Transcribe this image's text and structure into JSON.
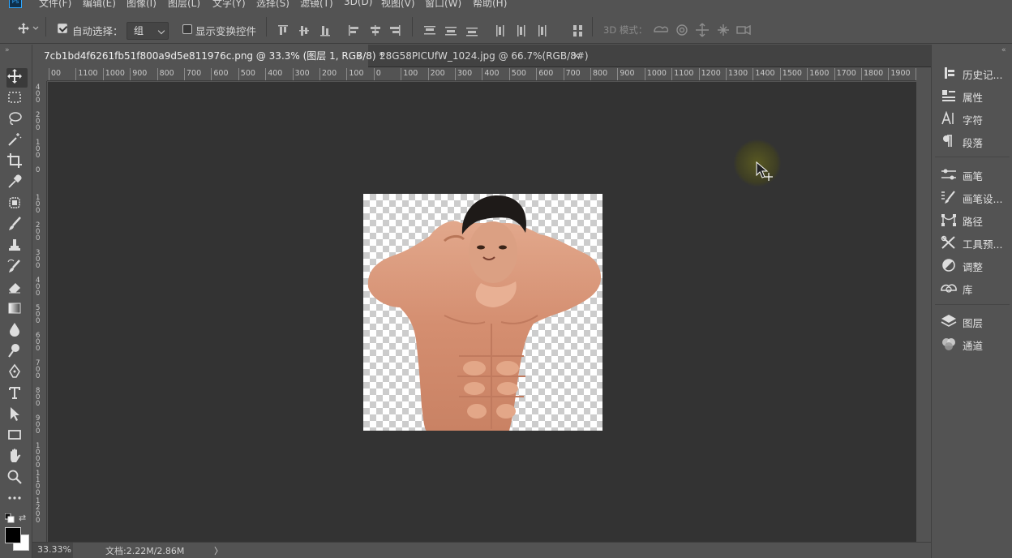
{
  "app": {
    "name": "Ps",
    "accent": "#31a8ff"
  },
  "menu": [
    "文件(F)",
    "编辑(E)",
    "图像(I)",
    "图层(L)",
    "文字(Y)",
    "选择(S)",
    "滤镜(T)",
    "3D(D)",
    "视图(V)",
    "窗口(W)",
    "帮助(H)"
  ],
  "options": {
    "auto_select_label": "自动选择：",
    "auto_select_checked": true,
    "auto_select_value": "组",
    "transform_label": "显示变换控件",
    "transform_checked": false,
    "mode_3d_label": "3D 模式："
  },
  "tabs": [
    {
      "label": "7cb1bd4f6261fb51f800a9d5e811976c.png @ 33.3% (图层 1, RGB/8) *",
      "close": "×",
      "active": true
    },
    {
      "label": "28G58PICUfW_1024.jpg @ 66.7%(RGB/8#)",
      "close": "×",
      "active": false
    }
  ],
  "ruler_h": [
    "00",
    "1100",
    "1000",
    "900",
    "800",
    "700",
    "600",
    "500",
    "400",
    "300",
    "200",
    "100",
    "0",
    "100",
    "200",
    "300",
    "400",
    "500",
    "600",
    "700",
    "800",
    "900",
    "1000",
    "1100",
    "1200",
    "1300",
    "1400",
    "1500",
    "1600",
    "1700",
    "1800",
    "1900",
    "200"
  ],
  "ruler_v": [
    "4\n0\n0",
    "2\n0\n0",
    "1\n0\n0",
    "0",
    "1\n0\n0",
    "2\n0\n0",
    "3\n0\n0",
    "4\n0\n0",
    "5\n0\n0",
    "6\n0\n0",
    "7\n0\n0",
    "8\n0\n0",
    "9\n0\n0",
    "1\n0\n0\n0",
    "1\n1\n0\n0",
    "1\n2\n0\n0"
  ],
  "right_panels": {
    "group1": [
      {
        "icon": "history-icon",
        "label": "历史记..."
      },
      {
        "icon": "properties-icon",
        "label": "属性"
      },
      {
        "icon": "character-icon",
        "label": "字符"
      },
      {
        "icon": "paragraph-icon",
        "label": "段落"
      }
    ],
    "group2": [
      {
        "icon": "brush-icon",
        "label": "画笔"
      },
      {
        "icon": "brush-settings-icon",
        "label": "画笔设..."
      },
      {
        "icon": "paths-icon",
        "label": "路径"
      },
      {
        "icon": "tool-presets-icon",
        "label": "工具预..."
      },
      {
        "icon": "adjustments-icon",
        "label": "调整"
      },
      {
        "icon": "libraries-icon",
        "label": "库"
      }
    ],
    "group3": [
      {
        "icon": "layers-icon",
        "label": "图层"
      },
      {
        "icon": "channels-icon",
        "label": "通道"
      }
    ]
  },
  "status": {
    "zoom": "33.33%",
    "doc_info": "文档:2.22M/2.86M",
    "arrow": "〉"
  }
}
